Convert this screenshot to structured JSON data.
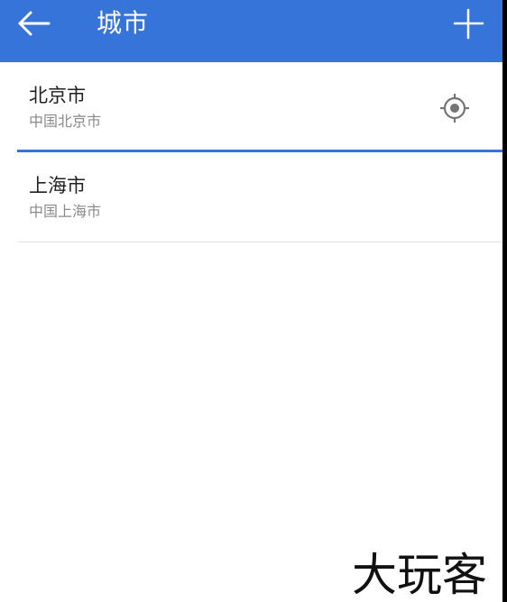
{
  "toolbar": {
    "title": "城市",
    "back_icon": "arrow-left-icon",
    "add_icon": "plus-icon",
    "color": "#3674DA"
  },
  "cities": [
    {
      "name": "北京市",
      "detail": "中国北京市",
      "current_location": true
    },
    {
      "name": "上海市",
      "detail": "中国上海市",
      "current_location": false
    }
  ],
  "watermark": {
    "text": "大玩客"
  }
}
